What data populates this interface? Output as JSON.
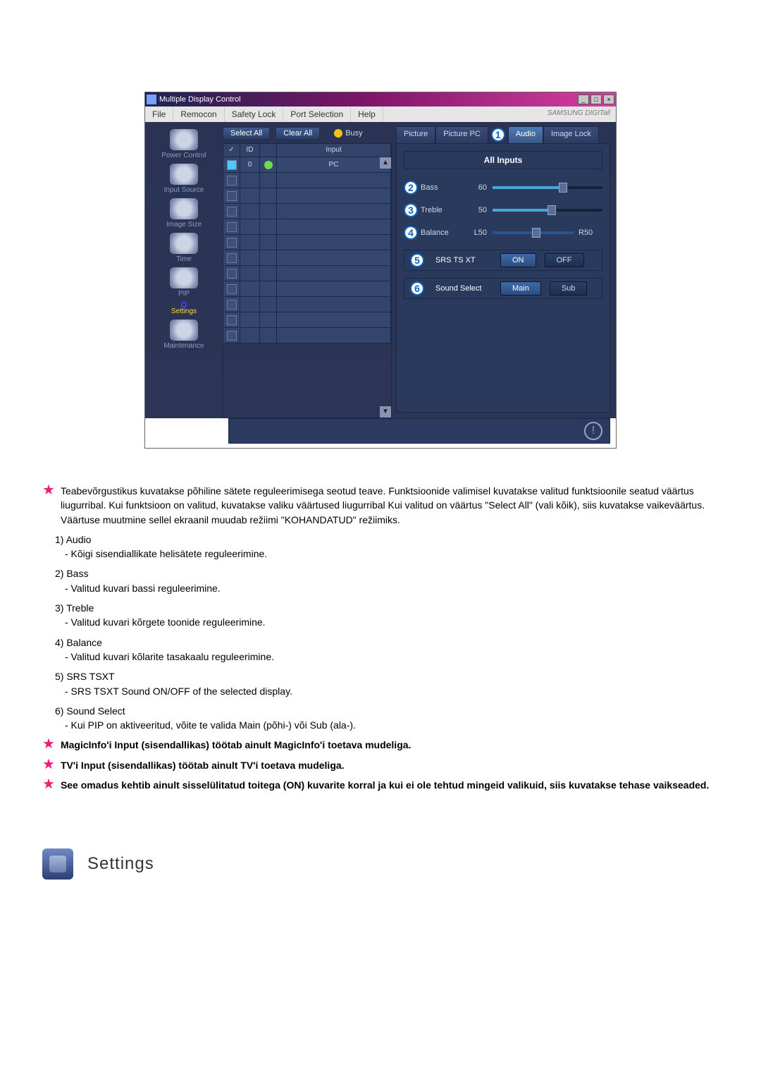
{
  "window": {
    "title": "Multiple Display Control",
    "win_min": "_",
    "win_max": "□",
    "win_close": "×"
  },
  "menu": {
    "file": "File",
    "remocon": "Remocon",
    "safety": "Safety Lock",
    "port": "Port Selection",
    "help": "Help",
    "brand": "SAMSUNG DIGITall"
  },
  "sidebar": {
    "items": [
      {
        "label": "Power Control"
      },
      {
        "label": "Input Source"
      },
      {
        "label": "Image Size"
      },
      {
        "label": "Time"
      },
      {
        "label": "PIP"
      },
      {
        "label": "Settings"
      },
      {
        "label": "Maintenance"
      }
    ]
  },
  "toolbar": {
    "select_all": "Select All",
    "clear_all": "Clear All",
    "busy": "Busy"
  },
  "grid": {
    "hdr_chk": "✓",
    "hdr_id": "ID",
    "hdr_input": "Input",
    "row0": {
      "id": "0",
      "input": "PC"
    }
  },
  "tabs": {
    "picture": "Picture",
    "picture_pc": "Picture PC",
    "audio": "Audio",
    "image_lock": "Image Lock"
  },
  "markers": {
    "m1": "1",
    "m2": "2",
    "m3": "3",
    "m4": "4",
    "m5": "5",
    "m6": "6"
  },
  "panel": {
    "title": "All Inputs",
    "bass_label": "Bass",
    "bass_val": "60",
    "treble_label": "Treble",
    "treble_val": "50",
    "balance_label": "Balance",
    "balance_left": "L50",
    "balance_right": "R50",
    "srs_label": "SRS TS XT",
    "on": "ON",
    "off": "OFF",
    "sound_select_label": "Sound Select",
    "main": "Main",
    "sub": "Sub"
  },
  "doc": {
    "note1": "Teabevõrgustikus kuvatakse põhiline sätete reguleerimisega seotud teave. Funktsioonide valimisel kuvatakse valitud funktsioonile seatud väärtus liugurribal. Kui funktsioon on valitud, kuvatakse valiku väärtused liugurribal Kui valitud on väärtus \"Select All\" (vali kõik), siis kuvatakse vaikeväärtus. Väärtuse muutmine sellel ekraanil muudab režiimi \"KOHANDATUD\" režiimiks.",
    "i1_num": "1)",
    "i1_title": "Audio",
    "i1_desc": "- Kõigi sisendiallikate helisätete reguleerimine.",
    "i2_num": "2)",
    "i2_title": "Bass",
    "i2_desc": "- Valitud kuvari bassi reguleerimine.",
    "i3_num": "3)",
    "i3_title": "Treble",
    "i3_desc": "- Valitud kuvari kõrgete toonide reguleerimine.",
    "i4_num": "4)",
    "i4_title": "Balance",
    "i4_desc": "- Valitud kuvari kõlarite tasakaalu reguleerimine.",
    "i5_num": "5)",
    "i5_title": "SRS TSXT",
    "i5_desc": "- SRS TSXT Sound ON/OFF of the selected display.",
    "i6_num": "6)",
    "i6_title": "Sound Select",
    "i6_desc": "- Kui PIP on aktiveeritud, võite te valida Main (põhi-) või Sub (ala-).",
    "note2": "MagicInfo'i Input (sisendallikas) töötab ainult MagicInfo'i toetava mudeliga.",
    "note3": "TV'i Input (sisendallikas) töötab ainult TV'i toetava mudeliga.",
    "note4": "See omadus kehtib ainult sisselülitatud toitega (ON) kuvarite korral ja kui ei ole tehtud mingeid valikuid, siis kuvatakse tehase vaikseaded.",
    "section_title": "Settings"
  }
}
